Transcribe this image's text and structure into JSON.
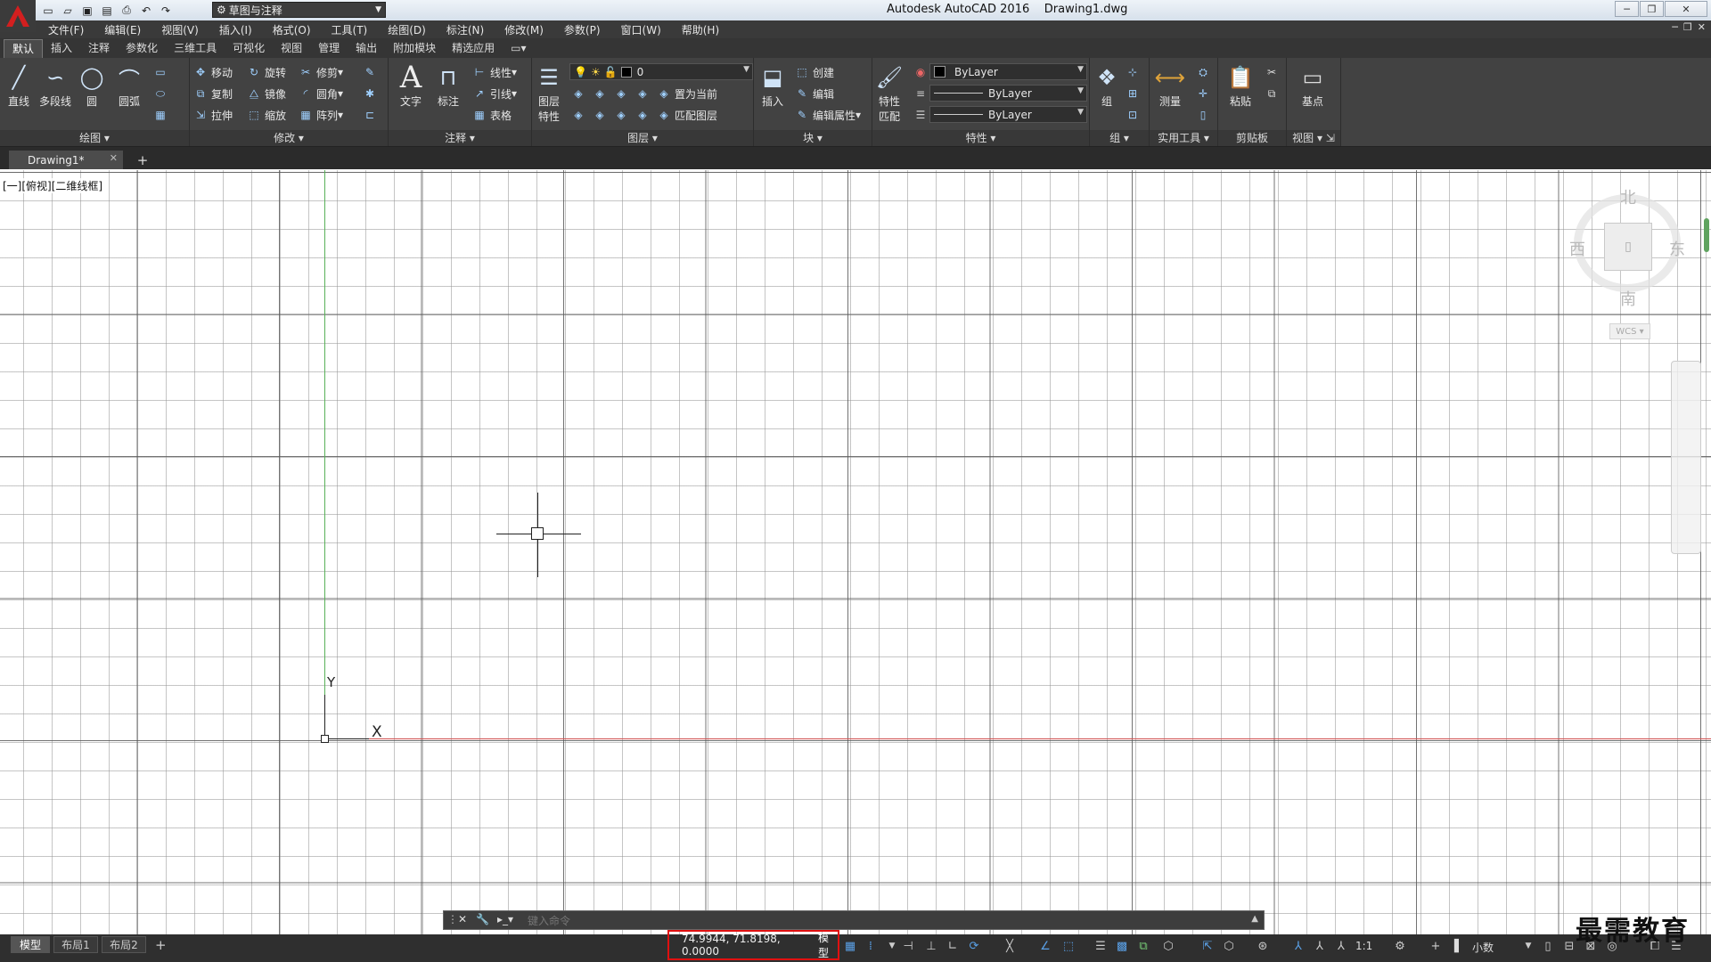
{
  "app": {
    "title": "Autodesk AutoCAD 2016    Drawing1.dwg",
    "workspace": "草图与注释",
    "logo_letter": "A"
  },
  "menu": [
    "文件(F)",
    "编辑(E)",
    "视图(V)",
    "插入(I)",
    "格式(O)",
    "工具(T)",
    "绘图(D)",
    "标注(N)",
    "修改(M)",
    "参数(P)",
    "窗口(W)",
    "帮助(H)"
  ],
  "ribbon_tabs": [
    "默认",
    "插入",
    "注释",
    "参数化",
    "三维工具",
    "可视化",
    "视图",
    "管理",
    "输出",
    "附加模块",
    "精选应用"
  ],
  "ribbon": {
    "draw": {
      "title": "绘图",
      "line": "直线",
      "polyline": "多段线",
      "circle": "圆",
      "arc": "圆弧"
    },
    "modify": {
      "title": "修改",
      "move": "移动",
      "rotate": "旋转",
      "trim": "修剪",
      "copy": "复制",
      "mirror": "镜像",
      "fillet": "圆角",
      "stretch": "拉伸",
      "scale": "缩放",
      "array": "阵列"
    },
    "annotation": {
      "title": "注释",
      "text": "文字",
      "dimension": "标注",
      "linear": "线性",
      "leader": "引线",
      "table": "表格"
    },
    "layers": {
      "title": "图层",
      "layer_props_1": "图层",
      "layer_props_2": "特性",
      "current_layer": "0",
      "set_current": "置为当前",
      "match_layer": "匹配图层"
    },
    "block": {
      "title": "块",
      "insert": "插入",
      "create": "创建",
      "edit": "编辑",
      "edit_attr": "编辑属性"
    },
    "properties": {
      "title": "特性",
      "match_1": "特性",
      "match_2": "匹配",
      "color": "ByLayer",
      "linetype": "ByLayer",
      "lineweight": "ByLayer"
    },
    "groups": {
      "title": "组",
      "group": "组"
    },
    "utilities": {
      "title": "实用工具",
      "measure": "测量"
    },
    "clipboard": {
      "title": "剪贴板",
      "paste": "粘贴"
    },
    "view": {
      "title": "视图",
      "base": "基点"
    }
  },
  "file_tab": "Drawing1*",
  "viewport_label": "[一][俯视][二维线框]",
  "ucs": {
    "x": "X",
    "y": "Y"
  },
  "viewcube": {
    "north": "北",
    "south": "南",
    "east": "东",
    "west": "西",
    "wcs": "WCS"
  },
  "command_placeholder": "键入命令",
  "layout_tabs": [
    "模型",
    "布局1",
    "布局2"
  ],
  "status": {
    "coordinates": "74.9944, 71.8198, 0.0000",
    "space": "模型",
    "scale": "1:1",
    "units": "小数"
  },
  "watermark": "最需教育"
}
